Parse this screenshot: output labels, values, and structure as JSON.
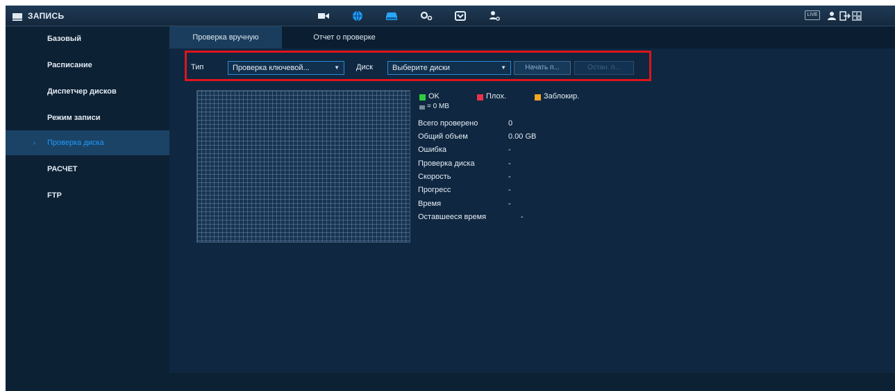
{
  "header": {
    "title": "ЗАПИСЬ",
    "live_label": "LIVE",
    "nav_icons": [
      "camera-icon",
      "network-icon",
      "storage-icon",
      "system-icon",
      "security-icon",
      "account-icon"
    ]
  },
  "sidebar": {
    "items": [
      {
        "label": "Базовый"
      },
      {
        "label": "Расписание"
      },
      {
        "label": "Диспетчер дисков"
      },
      {
        "label": "Режим записи"
      },
      {
        "label": "Проверка диска",
        "active": true
      },
      {
        "label": "РАСЧЕТ"
      },
      {
        "label": "FTP"
      }
    ]
  },
  "tabs": [
    {
      "label": "Проверка вручную",
      "active": true
    },
    {
      "label": "Отчет о проверке"
    }
  ],
  "filter": {
    "type_label": "Тип",
    "type_value": "Проверка ключевой...",
    "disk_label": "Диск",
    "disk_value": "Выберите диски",
    "start_button": "Начать п...",
    "stop_button": "Остан. п..."
  },
  "legend": {
    "ok": "OK",
    "bad": "Плох.",
    "blocked": "Заблокир.",
    "unit": "= 0 MB",
    "colors": {
      "ok": "#2ecc40",
      "bad": "#e8334a",
      "blocked": "#f5a623",
      "unit": "#7a8a99"
    }
  },
  "stats": [
    {
      "label": "Всего проверено",
      "value": "0"
    },
    {
      "label": "Общий объем",
      "value": "0.00 GB"
    },
    {
      "label": "Ошибка",
      "value": "-"
    },
    {
      "label": "Проверка диска",
      "value": "-"
    },
    {
      "label": "Скорость",
      "value": "-"
    },
    {
      "label": "Прогресс",
      "value": "-"
    },
    {
      "label": "Время",
      "value": "-"
    },
    {
      "label": "Оставшееся время",
      "value": "-"
    }
  ]
}
